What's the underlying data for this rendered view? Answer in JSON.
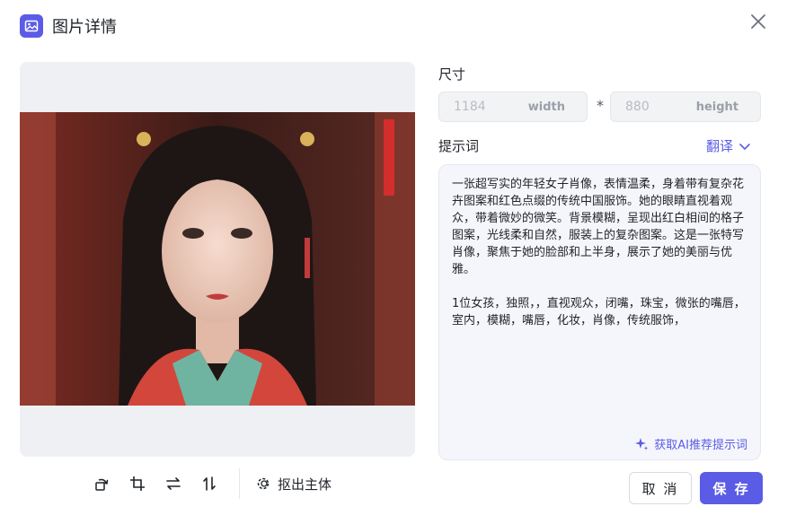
{
  "dialog": {
    "title": "图片详情",
    "icon": "image-icon",
    "close_icon": "close-icon"
  },
  "toolbar": {
    "tools": [
      "rotate-icon",
      "crop-icon",
      "flip-horizontal-icon",
      "flip-vertical-icon"
    ],
    "cutout_label": "抠出主体"
  },
  "size": {
    "label": "尺寸",
    "width_value": "1184",
    "width_unit": "width",
    "separator": "*",
    "height_value": "880",
    "height_unit": "height"
  },
  "prompt": {
    "label": "提示词",
    "translate_label": "翻译",
    "text": "一张超写实的年轻女子肖像，表情温柔，身着带有复杂花卉图案和红色点缀的传统中国服饰。她的眼睛直视着观众，带着微妙的微笑。背景模糊，呈现出红白相间的格子图案，光线柔和自然，服装上的复杂图案。这是一张特写肖像，聚焦于她的脸部和上半身，展示了她的美丽与优雅。\n\n1位女孩，独照，，直视观众，闭嘴，珠宝，微张的嘴唇，室内，模糊，嘴唇，化妆，肖像，传统服饰，",
    "ai_suggest_label": "获取AI推荐提示词"
  },
  "buttons": {
    "cancel": "取 消",
    "save": "保 存"
  },
  "colors": {
    "accent": "#5b5ce6",
    "preview_bg": "#eef0f4"
  }
}
